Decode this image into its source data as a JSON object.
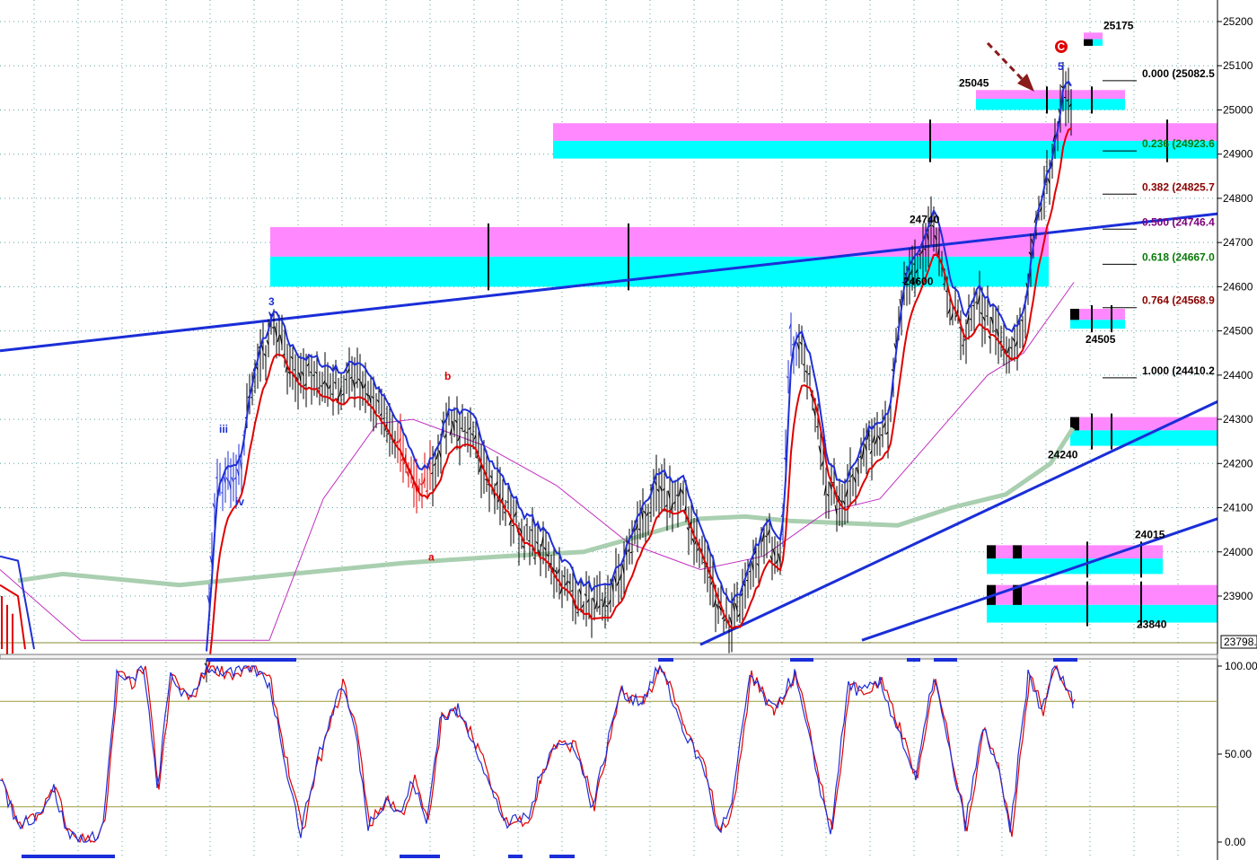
{
  "chart_data": [
    {
      "type": "candlestick",
      "ylim": [
        23798,
        25220
      ],
      "y_ticks": [
        "25200",
        "25100",
        "25000",
        "24900",
        "24800",
        "24700",
        "24600",
        "24500",
        "24400",
        "24300",
        "24200",
        "24100",
        "24000",
        "23900"
      ],
      "last_price_tag": "23798.",
      "grid": true,
      "colors": {
        "price": "#000000",
        "fast_line": "#1f2fd6",
        "slow_line": "#e00000",
        "ma_magenta": "#c030c0",
        "ma_green": "#a9cfb0",
        "trendline": "#1a2ed8",
        "zone_top": "#ff88ff",
        "zone_bottom": "#00ffff",
        "fib_green": "#0a7a0a",
        "fib_maroon": "#8b0000",
        "fib_purple": "#7a007a",
        "wave_label_blue": "#1a2ed8",
        "wave_label_red": "#e00000"
      },
      "fib_levels": [
        {
          "label": "0.000 (25082.5",
          "value": 25082.5,
          "color": "#000000"
        },
        {
          "label": "0.236 (24923.6",
          "value": 24923.6,
          "color": "#0a7a0a"
        },
        {
          "label": "0.382 (24825.7",
          "value": 24825.7,
          "color": "#8b0000"
        },
        {
          "label": "0.500 (24746.4",
          "value": 24746.4,
          "color": "#7a007a"
        },
        {
          "label": "0.618 (24667.0",
          "value": 24667.0,
          "color": "#0a7a0a"
        },
        {
          "label": "0.764 (24568.9",
          "value": 24568.9,
          "color": "#8b0000"
        },
        {
          "label": "1.000 (24410.2",
          "value": 24410.2,
          "color": "#000000"
        }
      ],
      "level_labels": [
        {
          "text": "25175",
          "value": 25175
        },
        {
          "text": "25045",
          "value": 25045
        },
        {
          "text": "24740",
          "value": 24740
        },
        {
          "text": "24600",
          "value": 24600
        },
        {
          "text": "24505",
          "value": 24505
        },
        {
          "text": "24240",
          "value": 24240
        },
        {
          "text": "24015",
          "value": 24015
        },
        {
          "text": "23840",
          "value": 23840
        }
      ],
      "wave_labels": [
        {
          "text": "3",
          "color": "blue"
        },
        {
          "text": "v",
          "color": "blue"
        },
        {
          "text": "iii",
          "color": "blue"
        },
        {
          "text": "iv",
          "color": "blue"
        },
        {
          "text": "b",
          "color": "red"
        },
        {
          "text": "a",
          "color": "red"
        },
        {
          "text": "5",
          "color": "blue"
        },
        {
          "text": "C",
          "color": "red-circle"
        }
      ]
    },
    {
      "type": "line",
      "ylim": [
        0,
        100
      ],
      "y_ticks": [
        "100.00",
        "50.00",
        "0.00"
      ],
      "overbought": 80,
      "oversold": 20,
      "series": [
        {
          "color": "#1f2fd6"
        },
        {
          "color": "#e00000"
        }
      ]
    }
  ]
}
